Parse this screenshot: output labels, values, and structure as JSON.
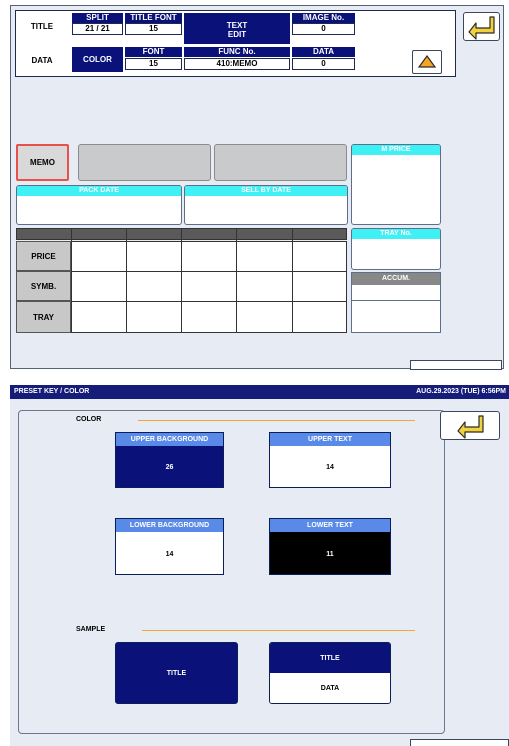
{
  "top": {
    "title_label": "TITLE",
    "data_label": "DATA",
    "split_header": "SPLIT",
    "split_value": "21 / 21",
    "title_font_header": "TITLE FONT",
    "title_font_value": "15",
    "text_edit_line1": "TEXT",
    "text_edit_line2": "EDIT",
    "image_no_header": "IMAGE No.",
    "image_no_value": "0",
    "color_button": "COLOR",
    "font_header": "FONT",
    "font_value": "15",
    "func_no_header": "FUNC No.",
    "func_no_value": "410:MEMO",
    "data_header": "DATA",
    "data_value": "0",
    "memo_button": "MEMO",
    "m_price_header": "M PRICE",
    "pack_date_header": "PACK DATE",
    "sell_by_date_header": "SELL BY DATE",
    "tray_no_header": "TRAY No.",
    "accum_header": "ACCUM.",
    "rows": [
      "PRICE",
      "SYMB.",
      "TRAY"
    ]
  },
  "bottom": {
    "title_bar": "PRESET KEY / COLOR",
    "datetime": "AUG.29.2023 (TUE)  6:56PM",
    "color_section": "COLOR",
    "upper_background_header": "UPPER BACKGROUND",
    "upper_background_value": "26",
    "upper_text_header": "UPPER TEXT",
    "upper_text_value": "14",
    "lower_background_header": "LOWER BACKGROUND",
    "lower_background_value": "14",
    "lower_text_header": "LOWER TEXT",
    "lower_text_value": "11",
    "sample_section": "SAMPLE",
    "sample1_title": "TITLE",
    "sample2_title": "TITLE",
    "sample2_data": "DATA"
  },
  "colors": {
    "navy": "#0a127a",
    "cyan": "#3ff0f5",
    "blue_header": "#5a8ae8",
    "orange": "#f4a634",
    "background": "#e7ebf4",
    "memo_border": "#e8504a"
  },
  "icons": [
    "back-arrow-icon",
    "up-triangle-icon"
  ]
}
